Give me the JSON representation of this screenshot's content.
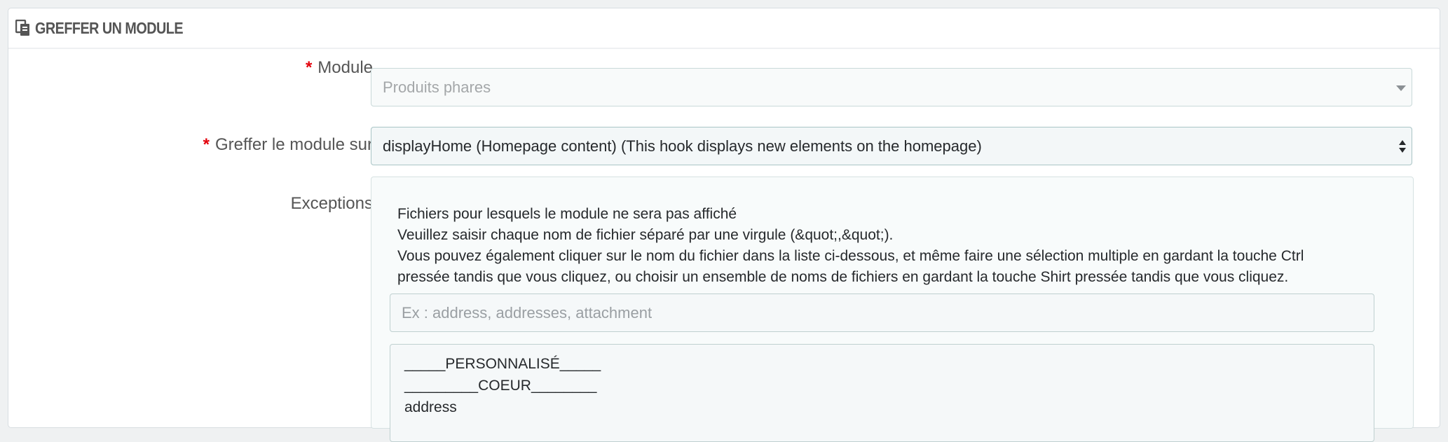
{
  "panel": {
    "title": "GREFFER UN MODULE",
    "icon": "module-graft-icon"
  },
  "form": {
    "required_marker": "*",
    "module": {
      "label": "Module",
      "selected": "Produits phares"
    },
    "hook": {
      "label": "Greffer le module sur",
      "selected": "displayHome (Homepage content) (This hook displays new elements on the homepage)"
    },
    "exceptions": {
      "label": "Exceptions",
      "help_lines": [
        "Fichiers pour lesquels le module ne sera pas affiché",
        "Veuillez saisir chaque nom de fichier séparé par une virgule (&quot;,&quot;).",
        "Vous pouvez également cliquer sur le nom du fichier dans la liste ci-dessous, et même faire une sélection multiple en gardant la touche Ctrl",
        "pressée tandis que vous cliquez, ou choisir un ensemble de noms de fichiers en gardant la touche Shirt pressée tandis que vous cliquez."
      ],
      "input_placeholder": "Ex : address, addresses, attachment",
      "options": [
        "_____PERSONNALISÉ_____",
        "_________COEUR________",
        "address"
      ]
    }
  },
  "colors": {
    "required": "#e3000b",
    "text": "#363a41",
    "border": "#bfd0d0"
  }
}
